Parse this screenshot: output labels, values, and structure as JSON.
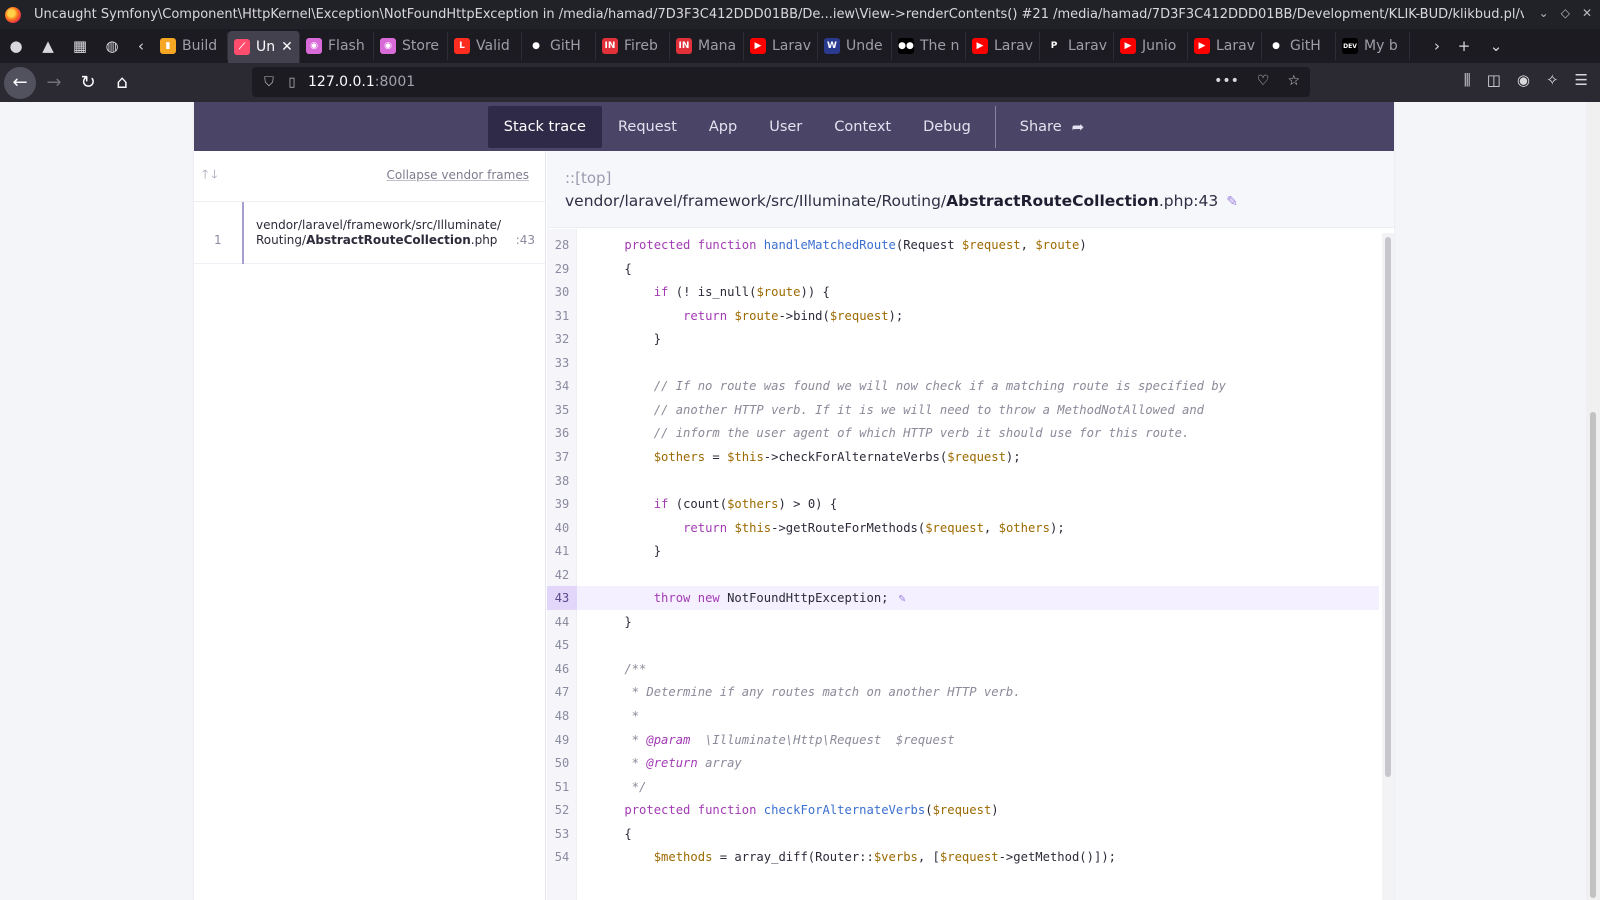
{
  "window": {
    "title": "Uncaught Symfony\\Component\\HttpKernel\\Exception\\NotFoundHttpException in /media/hamad/7D3F3C412DDD01BB/De...iew\\View->renderContents() #21 /media/hamad/7D3F3C412DDD01BB/Development/KLIK-BUD/klikbud.pl/vendor/larave"
  },
  "tabs": [
    {
      "label": "Build",
      "icon": "build-icon",
      "color": "#f5a623",
      "glyph": "▮"
    },
    {
      "label": "Un",
      "icon": "ignition-icon",
      "color": "#ff4d6d",
      "glyph": "⟋",
      "active": true
    },
    {
      "label": "Flash",
      "icon": "flash-icon",
      "color": "#d96bd9",
      "glyph": "◉"
    },
    {
      "label": "Store",
      "icon": "store-icon",
      "color": "#d96bd9",
      "glyph": "◉"
    },
    {
      "label": "Valid",
      "icon": "laravel-icon",
      "color": "#ff2d20",
      "glyph": "L"
    },
    {
      "label": "GitH",
      "icon": "github-icon",
      "color": "#1c1b22",
      "glyph": "●"
    },
    {
      "label": "Fireb",
      "icon": "in-icon",
      "color": "#e0303a",
      "glyph": "IN"
    },
    {
      "label": "Mana",
      "icon": "in-icon",
      "color": "#e0303a",
      "glyph": "IN"
    },
    {
      "label": "Larav",
      "icon": "youtube-icon",
      "color": "#ff0000",
      "glyph": "▶"
    },
    {
      "label": "Unde",
      "icon": "site-icon",
      "color": "#2a3b8f",
      "glyph": "W"
    },
    {
      "label": "The n",
      "icon": "medium-icon",
      "color": "#000000",
      "glyph": "●●"
    },
    {
      "label": "Larav",
      "icon": "youtube-icon",
      "color": "#ff0000",
      "glyph": "▶"
    },
    {
      "label": "Larav",
      "icon": "p-icon",
      "color": "#1c1b22",
      "glyph": "P"
    },
    {
      "label": "Junio",
      "icon": "youtube-icon",
      "color": "#ff0000",
      "glyph": "▶"
    },
    {
      "label": "Larav",
      "icon": "youtube-icon",
      "color": "#ff0000",
      "glyph": "▶"
    },
    {
      "label": "GitH",
      "icon": "github-icon",
      "color": "#1c1b22",
      "glyph": "●"
    },
    {
      "label": "My b",
      "icon": "dev-icon",
      "color": "#000000",
      "glyph": "DEV"
    }
  ],
  "url": {
    "host": "127.0.0.1",
    "port": ":8001"
  },
  "menu": {
    "items": [
      "Stack trace",
      "Request",
      "App",
      "User",
      "Context",
      "Debug"
    ],
    "share": "Share"
  },
  "sidebar": {
    "collapse_label": "Collapse vendor frames",
    "frames": [
      {
        "number": "1",
        "path_prefix": "vendor/laravel/framework/src/Illuminate/",
        "path_dir": "Routing/",
        "file": "AbstractRouteCollection",
        "ext": ".php",
        "line": ":43"
      }
    ]
  },
  "file": {
    "namespace": "::[top]",
    "path": "vendor/laravel/framework/src/Illuminate/Routing/",
    "name": "AbstractRouteCollection",
    "suffix": ".php:43"
  },
  "code": {
    "highlight_line": 43,
    "lines": [
      {
        "n": 28,
        "t": "    protected function handleMatchedRoute(Request $request, $route)"
      },
      {
        "n": 29,
        "t": "    {"
      },
      {
        "n": 30,
        "t": "        if (! is_null($route)) {"
      },
      {
        "n": 31,
        "t": "            return $route->bind($request);"
      },
      {
        "n": 32,
        "t": "        }"
      },
      {
        "n": 33,
        "t": ""
      },
      {
        "n": 34,
        "t": "        // If no route was found we will now check if a matching route is specified by"
      },
      {
        "n": 35,
        "t": "        // another HTTP verb. If it is we will need to throw a MethodNotAllowed and"
      },
      {
        "n": 36,
        "t": "        // inform the user agent of which HTTP verb it should use for this route."
      },
      {
        "n": 37,
        "t": "        $others = $this->checkForAlternateVerbs($request);"
      },
      {
        "n": 38,
        "t": ""
      },
      {
        "n": 39,
        "t": "        if (count($others) > 0) {"
      },
      {
        "n": 40,
        "t": "            return $this->getRouteForMethods($request, $others);"
      },
      {
        "n": 41,
        "t": "        }"
      },
      {
        "n": 42,
        "t": ""
      },
      {
        "n": 43,
        "t": "        throw new NotFoundHttpException;"
      },
      {
        "n": 44,
        "t": "    }"
      },
      {
        "n": 45,
        "t": ""
      },
      {
        "n": 46,
        "t": "    /**"
      },
      {
        "n": 47,
        "t": "     * Determine if any routes match on another HTTP verb."
      },
      {
        "n": 48,
        "t": "     *"
      },
      {
        "n": 49,
        "t": "     * @param  \\Illuminate\\Http\\Request  $request"
      },
      {
        "n": 50,
        "t": "     * @return array"
      },
      {
        "n": 51,
        "t": "     */"
      },
      {
        "n": 52,
        "t": "    protected function checkForAlternateVerbs($request)"
      },
      {
        "n": 53,
        "t": "    {"
      },
      {
        "n": 54,
        "t": "        $methods = array_diff(Router::$verbs, [$request->getMethod()]);"
      }
    ]
  }
}
